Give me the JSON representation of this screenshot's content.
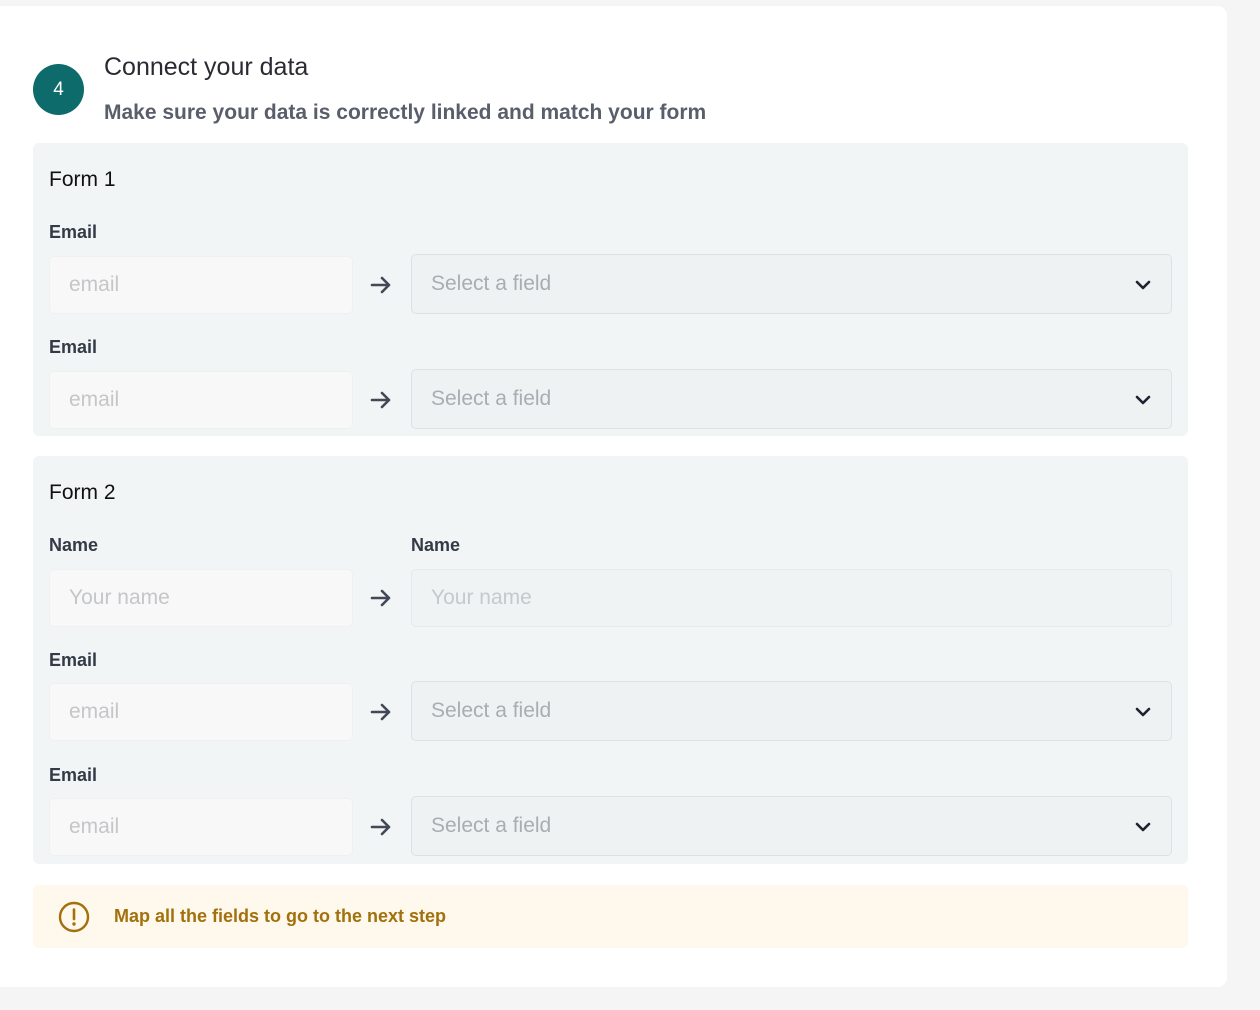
{
  "step": {
    "number": "4",
    "title": "Connect your data",
    "subtitle": "Make sure your data is correctly linked and match your form"
  },
  "forms": [
    {
      "title": "Form 1",
      "rows": [
        {
          "label": "Email",
          "source_placeholder": "email",
          "target_placeholder": "Select a field"
        },
        {
          "label": "Email",
          "source_placeholder": "email",
          "target_placeholder": "Select a field"
        }
      ]
    },
    {
      "title": "Form 2",
      "rows": [
        {
          "label": "Name",
          "target_label": "Name",
          "source_placeholder": "Your name",
          "target_placeholder": "Your name"
        },
        {
          "label": "Email",
          "source_placeholder": "email",
          "target_placeholder": "Select a field"
        },
        {
          "label": "Email",
          "source_placeholder": "email",
          "target_placeholder": "Select a field"
        }
      ]
    }
  ],
  "warning": {
    "message": "Map all the fields to go to the next step",
    "icon": "exclamation-circle-icon"
  },
  "colors": {
    "accent": "#0d6b6b",
    "warning_text": "#a2700c",
    "warning_bg": "#fff8ec"
  }
}
